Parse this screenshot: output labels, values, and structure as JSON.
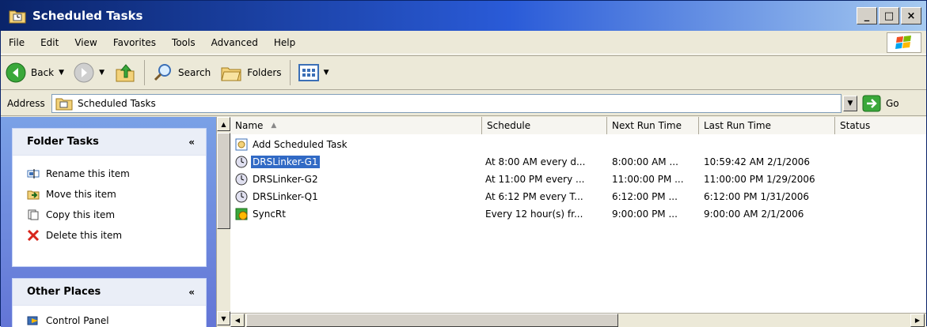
{
  "window": {
    "title": "Scheduled Tasks",
    "minimize": "_",
    "maximize": "□",
    "close": "×"
  },
  "menu": [
    "File",
    "Edit",
    "View",
    "Favorites",
    "Tools",
    "Advanced",
    "Help"
  ],
  "toolbar": {
    "back": "Back",
    "search": "Search",
    "folders": "Folders"
  },
  "address": {
    "label": "Address",
    "value": "Scheduled Tasks",
    "go": "Go"
  },
  "folder_tasks": {
    "title": "Folder Tasks",
    "items": [
      "Rename this item",
      "Move this item",
      "Copy this item",
      "Delete this item"
    ]
  },
  "other_places": {
    "title": "Other Places",
    "items": [
      "Control Panel"
    ]
  },
  "columns": [
    "Name",
    "Schedule",
    "Next Run Time",
    "Last Run Time",
    "Status"
  ],
  "rows": [
    {
      "name": "Add Scheduled Task",
      "schedule": "",
      "next": "",
      "last": "",
      "status": ""
    },
    {
      "name": "DRSLinker-G1",
      "schedule": "At 8:00 AM every d...",
      "next": "8:00:00 AM ...",
      "last": "10:59:42 AM  2/1/2006",
      "status": ""
    },
    {
      "name": "DRSLinker-G2",
      "schedule": "At 11:00 PM every ...",
      "next": "11:00:00 PM ...",
      "last": "11:00:00 PM  1/29/2006",
      "status": ""
    },
    {
      "name": "DRSLinker-Q1",
      "schedule": "At 6:12 PM every T...",
      "next": "6:12:00 PM ...",
      "last": "6:12:00 PM  1/31/2006",
      "status": ""
    },
    {
      "name": "SyncRt",
      "schedule": "Every 12 hour(s) fr...",
      "next": "9:00:00 PM ...",
      "last": "9:00:00 AM  2/1/2006",
      "status": ""
    }
  ],
  "colors": {
    "title_bar": "#0a246a",
    "task_pane": "#7aa1e6",
    "selection": "#316ac5"
  }
}
